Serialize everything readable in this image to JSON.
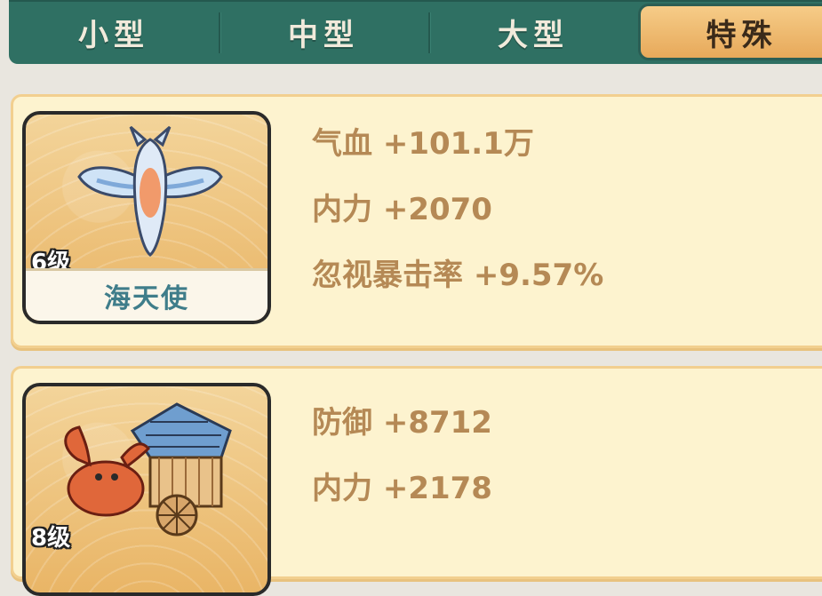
{
  "tabs": [
    {
      "label": "小型",
      "active": false
    },
    {
      "label": "中型",
      "active": false
    },
    {
      "label": "大型",
      "active": false
    },
    {
      "label": "特殊",
      "active": true
    }
  ],
  "cards": [
    {
      "name": "海天使",
      "level": "6级",
      "icon": "sea-angel-icon",
      "stats": [
        "气血 +101.1万",
        "内力 +2070",
        "忽视暴击率 +9.57%"
      ]
    },
    {
      "name": "",
      "level": "8级",
      "icon": "crab-cart-icon",
      "stats": [
        "防御 +8712",
        "内力 +2178"
      ]
    }
  ],
  "colors": {
    "tab_bar": "#2f7063",
    "tab_active": "#eab46a",
    "card_bg": "#fdf3cf",
    "stat_text": "#b58955",
    "name_text": "#3f7d8a"
  }
}
